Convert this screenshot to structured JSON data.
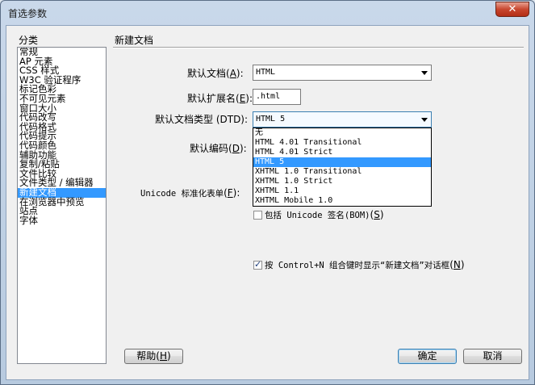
{
  "window": {
    "title": "首选参数",
    "close_glyph": "✕"
  },
  "category": {
    "label": "分类",
    "items": [
      "常规",
      "AP 元素",
      "CSS 样式",
      "W3C 验证程序",
      "标记色彩",
      "不可见元素",
      "窗口大小",
      "代码改写",
      "代码格式",
      "代码提示",
      "代码颜色",
      "辅助功能",
      "复制/粘贴",
      "文件比较",
      "文件类型 / 编辑器",
      "新建文档",
      "在浏览器中预览",
      "站点",
      "字体"
    ],
    "selected": "新建文档"
  },
  "section": {
    "title": "新建文档"
  },
  "default_doc": {
    "label": "默认文档",
    "key": "A",
    "value": "HTML"
  },
  "default_ext": {
    "label": "默认扩展名",
    "key": "E",
    "value": ".html"
  },
  "default_doctype": {
    "label": "默认文档类型 (DTD)",
    "key": "",
    "value": "HTML 5",
    "options": [
      "无",
      "HTML 4.01 Transitional",
      "HTML 4.01 Strict",
      "HTML 5",
      "XHTML 1.0 Transitional",
      "XHTML 1.0 Strict",
      "XHTML 1.1",
      "XHTML Mobile 1.0"
    ],
    "selected": "HTML 5"
  },
  "default_encoding": {
    "label": "默认编码",
    "key": "D"
  },
  "unicode_normal": {
    "label": "Unicode 标准化表单",
    "key": "F"
  },
  "bom_checkbox": {
    "label": "包括 Unicode 签名(BOM)",
    "key": "S",
    "checked": false
  },
  "show_dialog_checkbox": {
    "label": "按 Control+N 组合键时显示“新建文档”对话框",
    "key": "N",
    "checked": true
  },
  "buttons": {
    "help": "帮助",
    "help_key": "H",
    "ok": "确定",
    "cancel": "取消"
  }
}
